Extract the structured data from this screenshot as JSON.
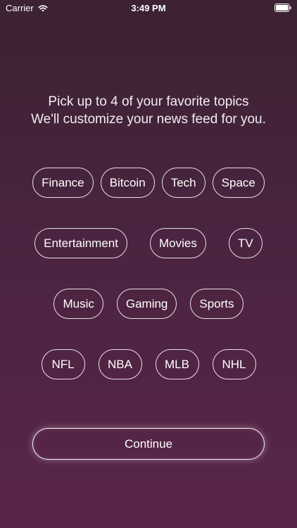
{
  "status_bar": {
    "carrier": "Carrier",
    "time": "3:49 PM",
    "icons": [
      "wifi-icon",
      "battery-icon"
    ]
  },
  "intro": {
    "line1": "Pick up to 4 of your favorite topics",
    "line2": "We'll customize your news feed for you."
  },
  "topics": {
    "row1": [
      "Finance",
      "Bitcoin",
      "Tech",
      "Space"
    ],
    "row2": [
      "Entertainment",
      "Movies",
      "TV"
    ],
    "row3": [
      "Music",
      "Gaming",
      "Sports"
    ],
    "row4": [
      "NFL",
      "NBA",
      "MLB",
      "NHL"
    ]
  },
  "continue_label": "Continue",
  "colors": {
    "background_top": "#3c2233",
    "background_bottom": "#5a2549",
    "chip_border": "#e8e0e6",
    "text": "#ffffff"
  }
}
